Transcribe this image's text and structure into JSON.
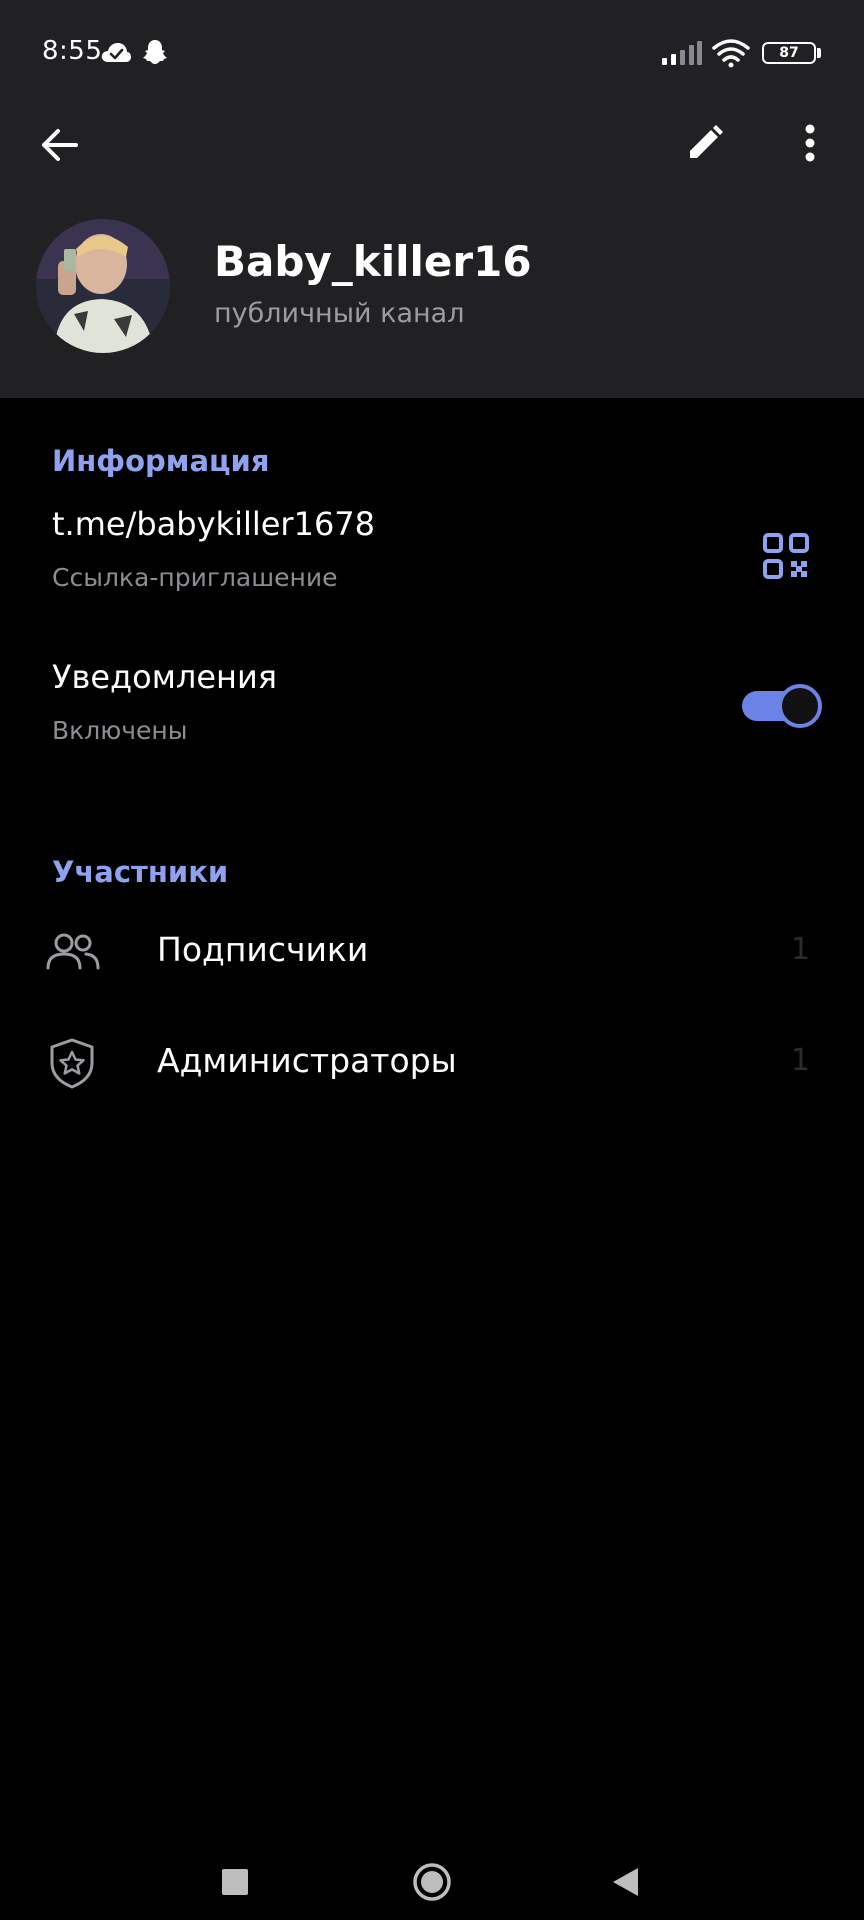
{
  "status_bar": {
    "time": "8:55",
    "battery": "87",
    "icons": [
      "cloud-check-icon",
      "snapchat-ghost-icon",
      "signal-icon",
      "wifi-icon",
      "battery-icon"
    ]
  },
  "app_bar": {
    "icons": [
      "back-arrow-icon",
      "edit-pencil-icon",
      "more-vertical-icon"
    ]
  },
  "profile": {
    "name": "Baby_killer16",
    "type": "публичный канал"
  },
  "info": {
    "section_title": "Информация",
    "link": "t.me/babykiller1678",
    "link_caption": "Ссылка-приглашение",
    "notifications_label": "Уведомления",
    "notifications_status": "Включены",
    "notifications_on": true
  },
  "members": {
    "section_title": "Участники",
    "subscribers_label": "Подписчики",
    "subscribers_count": "1",
    "admins_label": "Администраторы",
    "admins_count": "1"
  },
  "colors": {
    "accent": "#8fa2ef",
    "toggle": "#6b83e6",
    "header_bg": "#212023",
    "body_bg": "#000000"
  }
}
